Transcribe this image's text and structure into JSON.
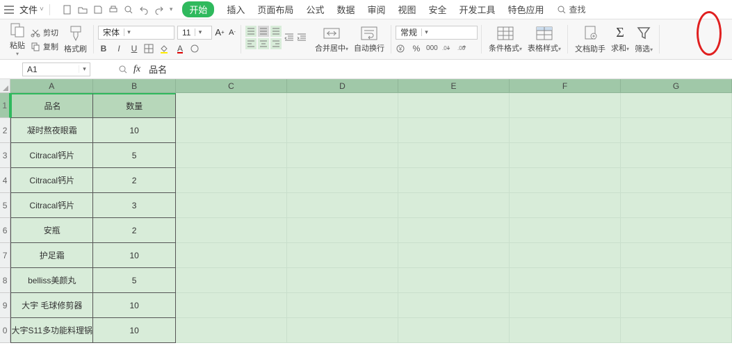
{
  "menubar": {
    "file": "文件",
    "tabs": [
      "开始",
      "插入",
      "页面布局",
      "公式",
      "数据",
      "审阅",
      "视图",
      "安全",
      "开发工具",
      "特色应用"
    ],
    "search": "查找"
  },
  "ribbon": {
    "paste": "粘贴",
    "cut": "剪切",
    "copy": "复制",
    "format_painter": "格式刷",
    "font_name": "宋体",
    "font_size": "11",
    "merge_center": "合并居中",
    "wrap_text": "自动换行",
    "number_format": "常规",
    "cond_format": "条件格式",
    "table_style": "表格样式",
    "doc_helper": "文档助手",
    "sum": "求和",
    "filter": "筛选"
  },
  "formula_bar": {
    "name_box": "A1",
    "formula": "品名"
  },
  "columns": [
    "A",
    "B",
    "C",
    "D",
    "E",
    "F",
    "G"
  ],
  "row_headers": [
    "1",
    "2",
    "3",
    "4",
    "5",
    "6",
    "7",
    "8",
    "9",
    "0"
  ],
  "table": {
    "headers": {
      "a": "品名",
      "b": "数量"
    },
    "rows": [
      {
        "a": "凝时熬夜眼霜",
        "b": "10"
      },
      {
        "a": "Citracal钙片",
        "b": "5"
      },
      {
        "a": "Citracal钙片",
        "b": "2"
      },
      {
        "a": "Citracal钙片",
        "b": "3"
      },
      {
        "a": "安瓶",
        "b": "2"
      },
      {
        "a": "护足霜",
        "b": "10"
      },
      {
        "a": "belliss美颜丸",
        "b": "5"
      },
      {
        "a": "大宇 毛球修剪器",
        "b": "10"
      },
      {
        "a": "大宇S11多功能料理锅",
        "b": "10"
      }
    ]
  }
}
